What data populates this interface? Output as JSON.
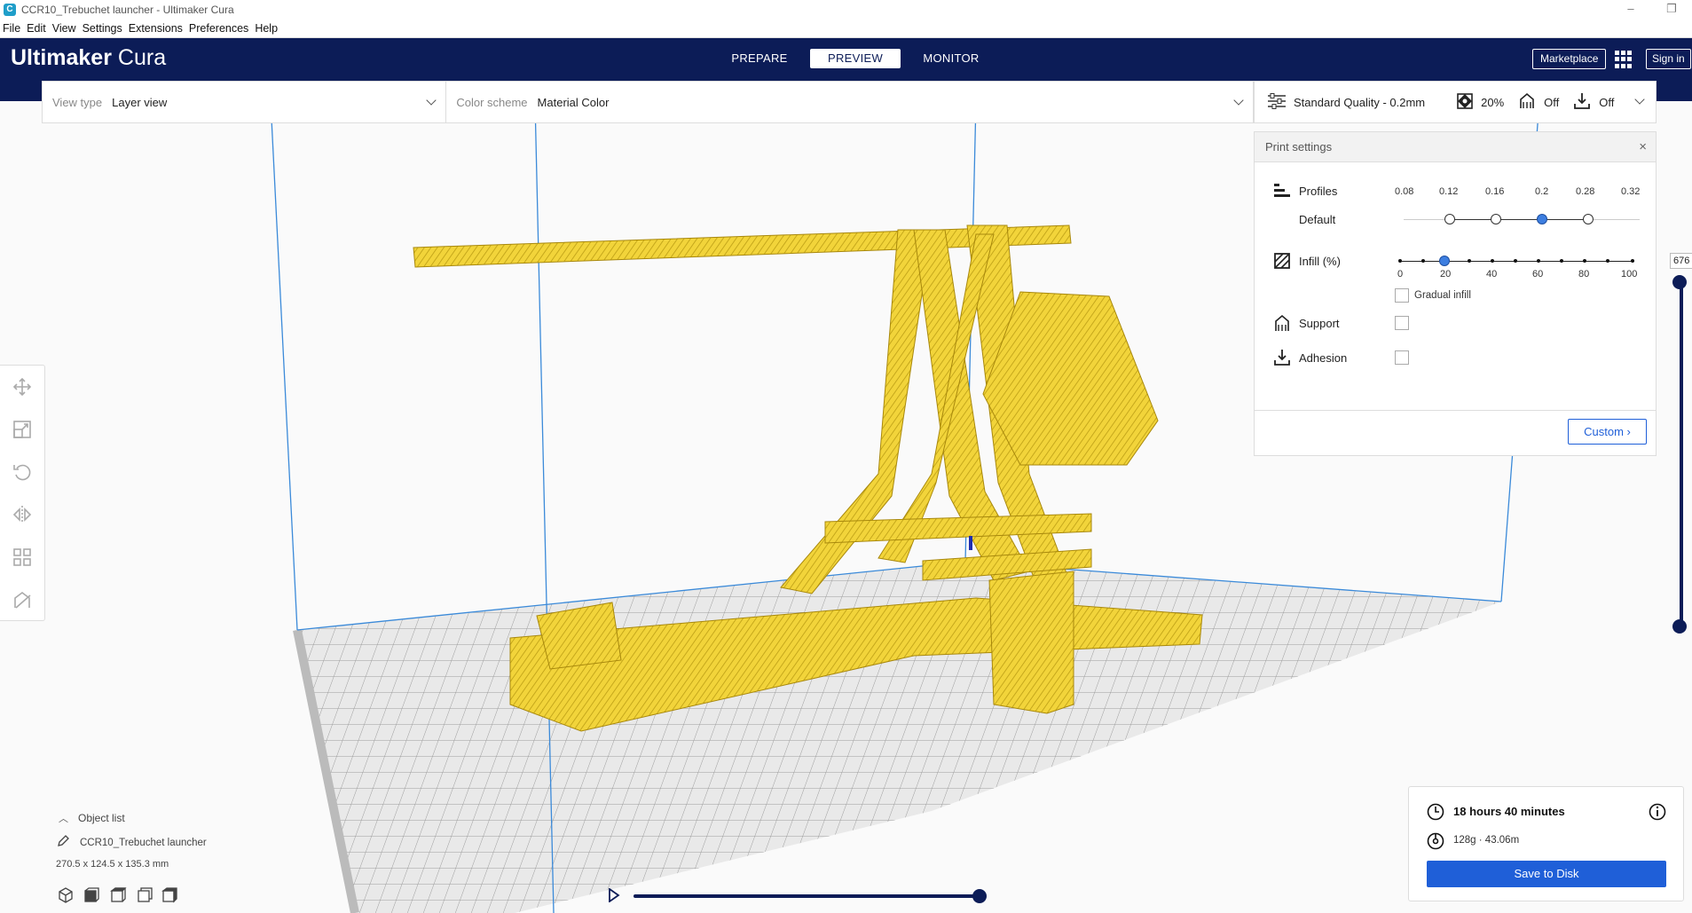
{
  "window": {
    "title": "CCR10_Trebuchet launcher - Ultimaker Cura",
    "controls": [
      "–",
      "❐"
    ]
  },
  "menu": [
    "File",
    "Edit",
    "View",
    "Settings",
    "Extensions",
    "Preferences",
    "Help"
  ],
  "header": {
    "brand_bold": "Ultimaker",
    "brand_light": "Cura",
    "stages": [
      "PREPARE",
      "PREVIEW",
      "MONITOR"
    ],
    "active_stage": "PREVIEW",
    "marketplace": "Marketplace",
    "signin": "Sign in"
  },
  "view": {
    "view_type_label": "View type",
    "view_type_value": "Layer view",
    "color_scheme_label": "Color scheme",
    "color_scheme_value": "Material Color"
  },
  "settings_bar": {
    "profile": "Standard Quality - 0.2mm",
    "infill": "20%",
    "support": "Off",
    "adhesion": "Off"
  },
  "print_settings": {
    "title": "Print settings",
    "close": "×",
    "profiles_label": "Profiles",
    "profile_default": "Default",
    "layer_heights": [
      "0.08",
      "0.12",
      "0.16",
      "0.2",
      "0.28",
      "0.32"
    ],
    "selected_layer_height": "0.2",
    "infill_label": "Infill (%)",
    "infill_ticks": [
      "0",
      "20",
      "40",
      "60",
      "80",
      "100"
    ],
    "infill_value": 20,
    "gradual_infill": "Gradual infill",
    "support_label": "Support",
    "adhesion_label": "Adhesion",
    "custom_button": "Custom"
  },
  "object_list": {
    "header": "Object list",
    "object_name": "CCR10_Trebuchet launcher",
    "dimensions": "270.5 x 124.5 x 135.3 mm"
  },
  "layer_view": {
    "current_layer": "676"
  },
  "output": {
    "print_time": "18 hours 40 minutes",
    "material": "128g · 43.06m",
    "save_button": "Save to Disk"
  },
  "colors": {
    "header_bg": "#0c1c57",
    "accent": "#1f5fd8",
    "model": "#f2d43a"
  }
}
